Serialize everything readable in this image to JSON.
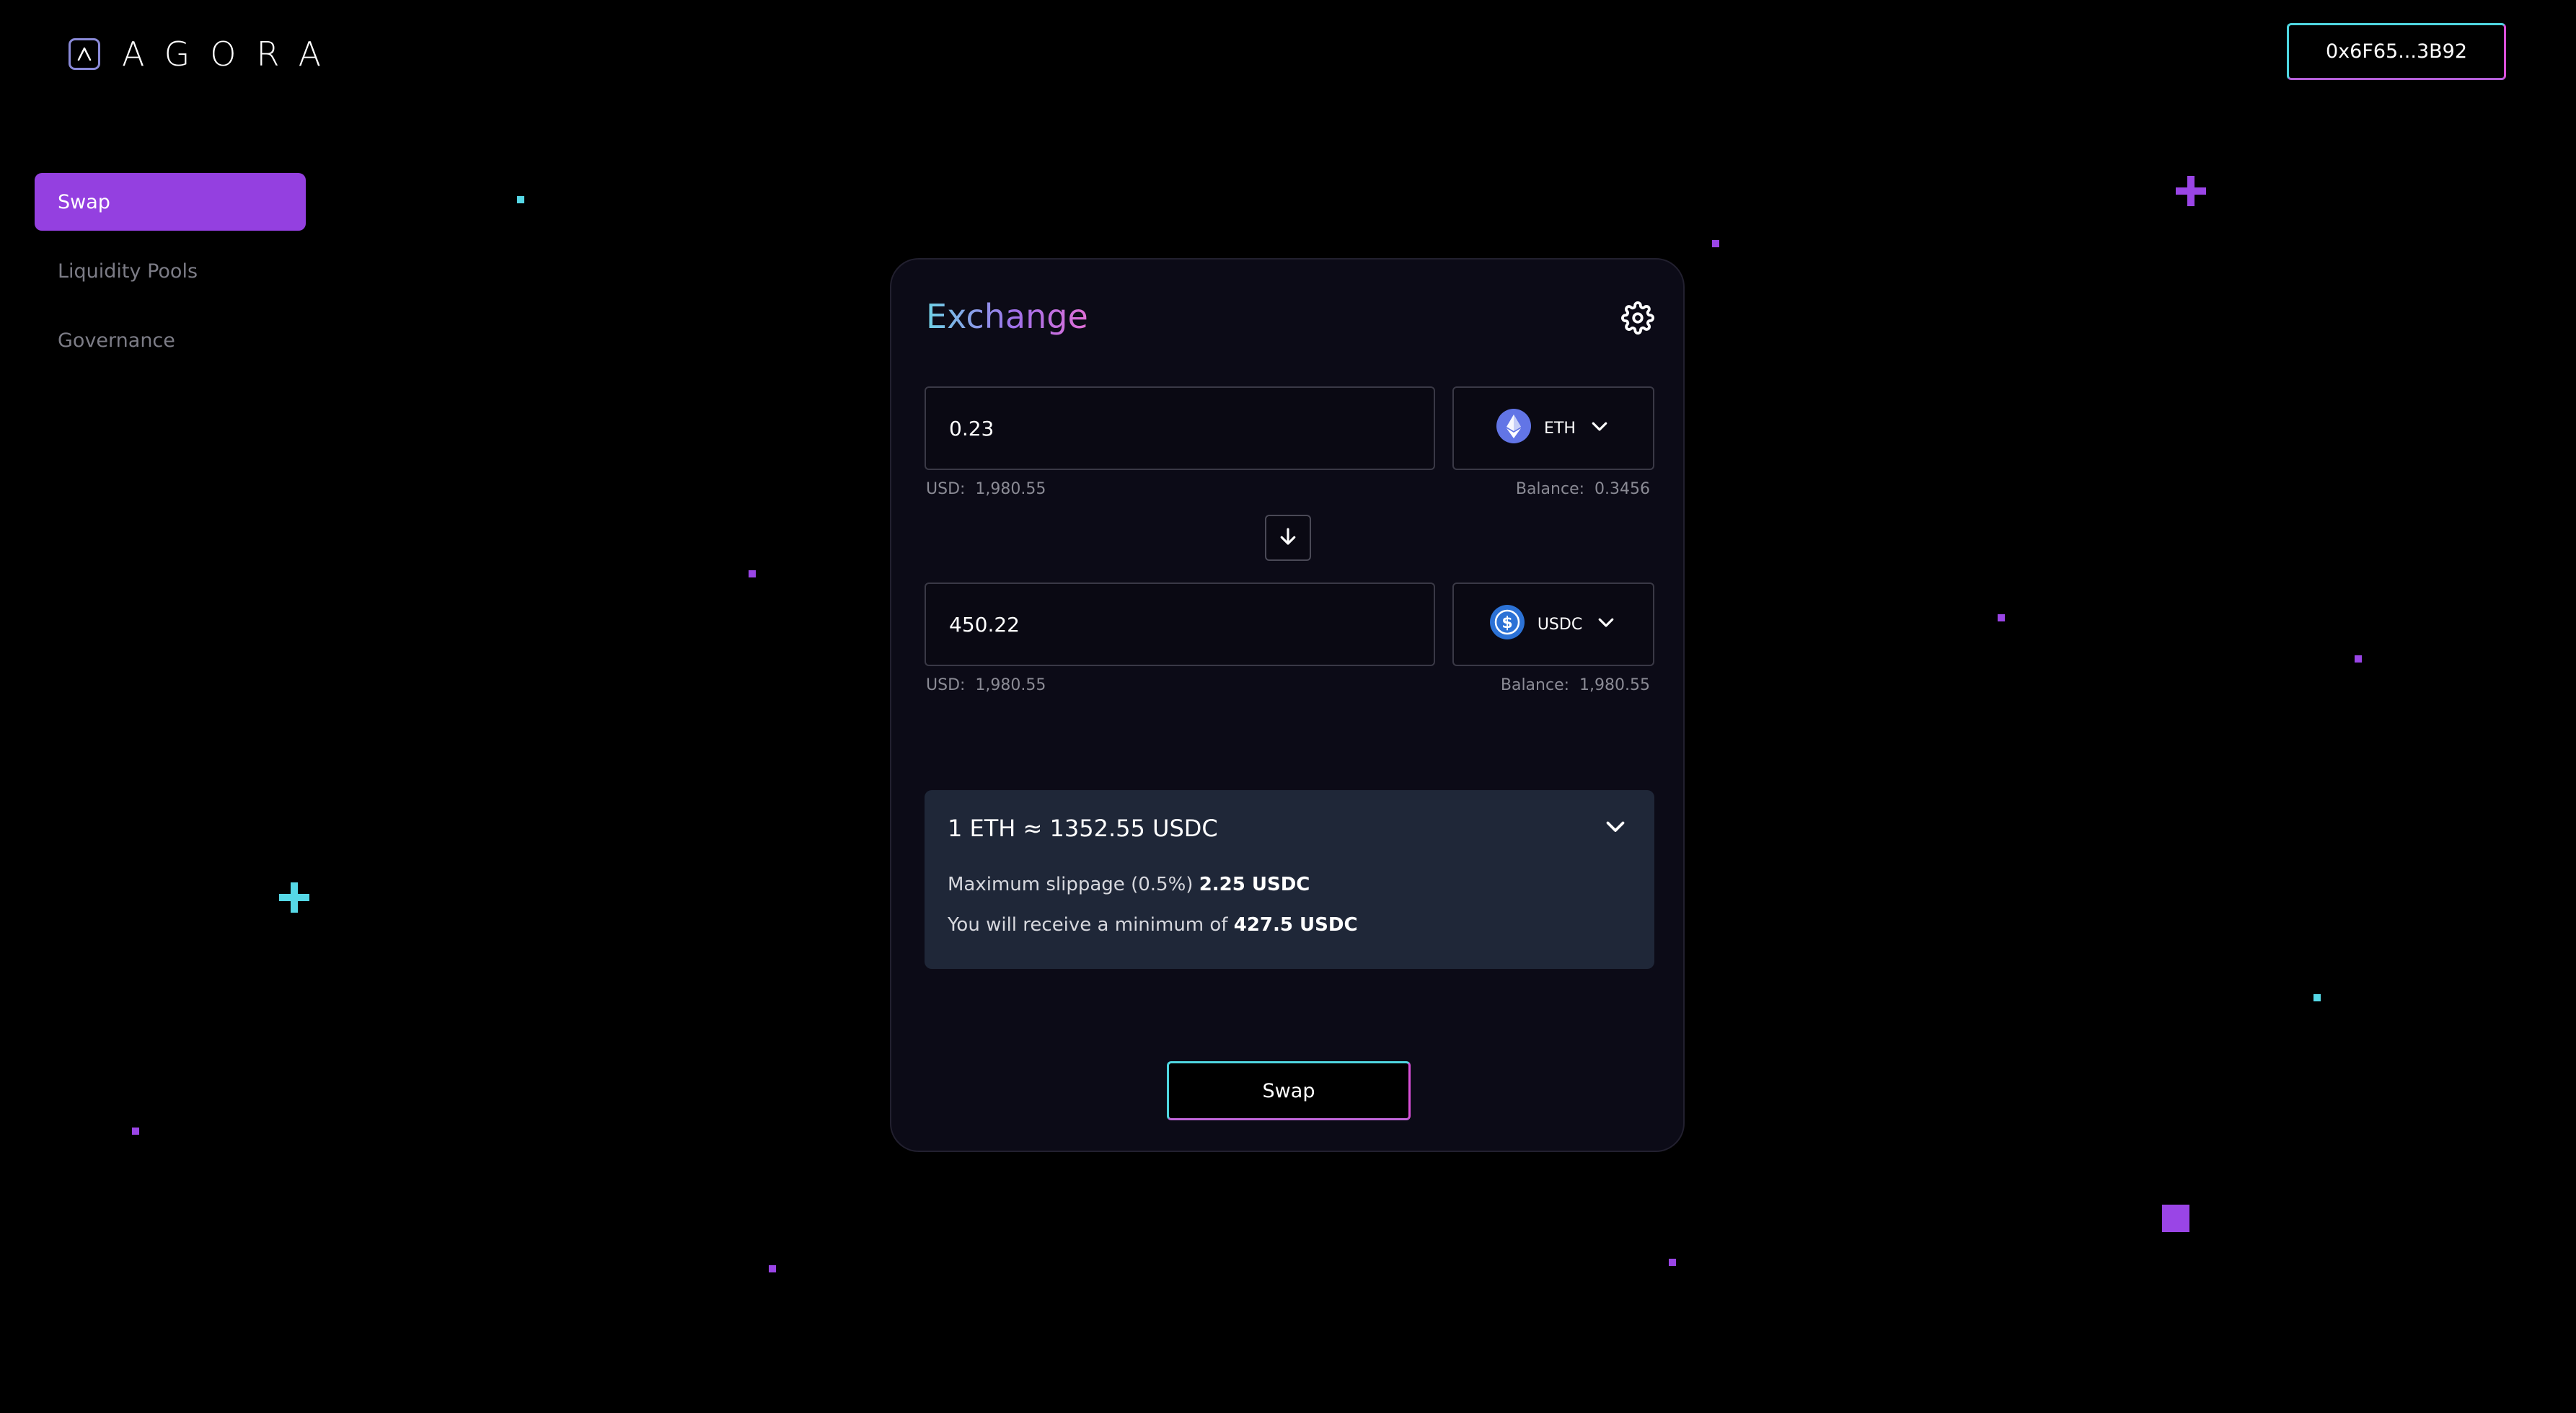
{
  "header": {
    "logo_mark": "Λ",
    "logo_text": "AGORA",
    "wallet_address": "0x6F65...3B92"
  },
  "sidebar": {
    "items": [
      {
        "label": "Swap",
        "active": true
      },
      {
        "label": "Liquidity Pools",
        "active": false
      },
      {
        "label": "Governance",
        "active": false
      }
    ]
  },
  "exchange": {
    "title": "Exchange",
    "settings_icon": "gear-icon",
    "from": {
      "amount": "0.23",
      "token": "ETH",
      "usd_label": "USD:",
      "usd_value": "1,980.55",
      "balance_label": "Balance:",
      "balance_value": "0.3456"
    },
    "to": {
      "amount": "450.22",
      "token": "USDC",
      "usd_label": "USD:",
      "usd_value": "1,980.55",
      "balance_label": "Balance:",
      "balance_value": "1,980.55"
    },
    "details": {
      "rate": "1 ETH ≈ 1352.55 USDC",
      "slippage_label": "Maximum slippage (0.5%)",
      "slippage_value": "2.25 USDC",
      "minimum_label": "You will receive a minimum of",
      "minimum_value": "427.5 USDC"
    },
    "swap_button": "Swap"
  },
  "colors": {
    "accent": "#9440e0",
    "cyan": "#4fd6e0",
    "pink": "#d94fd8",
    "card_bg": "#0c0b17",
    "details_bg": "#1f2738"
  }
}
